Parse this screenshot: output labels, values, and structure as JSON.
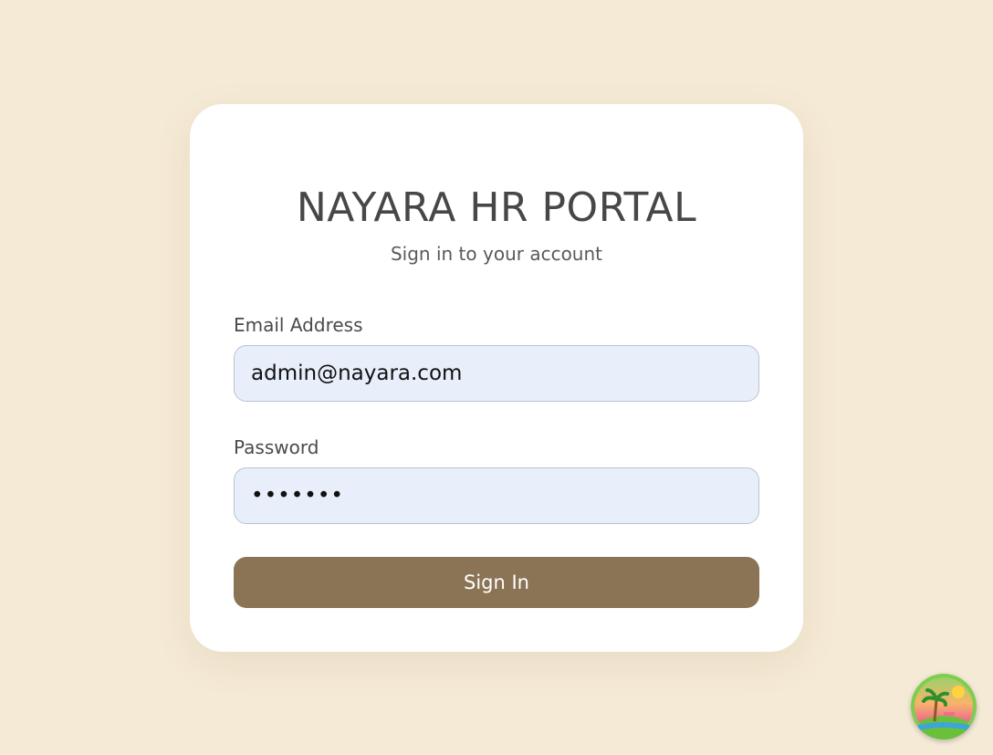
{
  "login": {
    "title": "NAYARA HR PORTAL",
    "subtitle": "Sign in to your account",
    "email_label": "Email Address",
    "email_value": "admin@nayara.com",
    "password_label": "Password",
    "password_value": "1234567",
    "submit_label": "Sign In"
  },
  "theme": {
    "background": "#f5ead6",
    "card": "#ffffff",
    "input_bg": "#e8effb",
    "button": "#8b7455"
  },
  "badge": {
    "icon": "tropical-island-icon"
  }
}
